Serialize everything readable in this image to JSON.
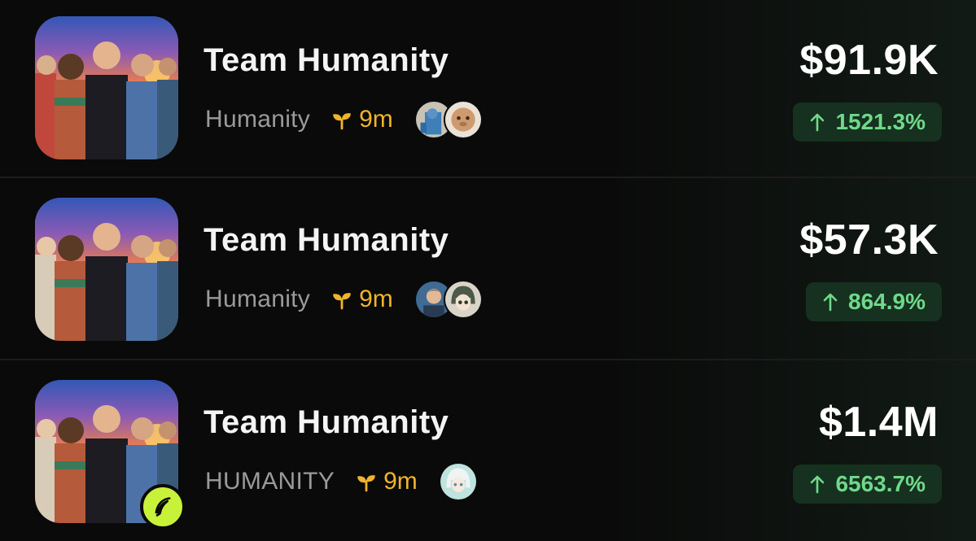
{
  "tokens": [
    {
      "name": "Team Humanity",
      "ticker": "Humanity",
      "age": "9m",
      "market_cap": "$91.9K",
      "change": "1521.3%",
      "change_color": "#6fd98a",
      "avatars": [
        "robot-avatar",
        "clay-face-avatar"
      ],
      "badge": false
    },
    {
      "name": "Team Humanity",
      "ticker": "Humanity",
      "age": "9m",
      "market_cap": "$57.3K",
      "change": "864.9%",
      "change_color": "#6fd98a",
      "avatars": [
        "man-photo-avatar",
        "anime-girl-avatar"
      ],
      "badge": false
    },
    {
      "name": "Team Humanity",
      "ticker": "HUMANITY",
      "age": "9m",
      "market_cap": "$1.4M",
      "change": "6563.7%",
      "change_color": "#6fd98a",
      "avatars": [
        "anime-white-hair-avatar"
      ],
      "badge": true
    }
  ],
  "colors": {
    "background": "#0a0a0a",
    "age_accent": "#f0b429",
    "positive": "#6fd98a",
    "badge": "#c8f23a"
  },
  "icons": {
    "age": "sprout-icon",
    "change": "arrow-up-icon",
    "badge": "feather-pen-icon"
  }
}
